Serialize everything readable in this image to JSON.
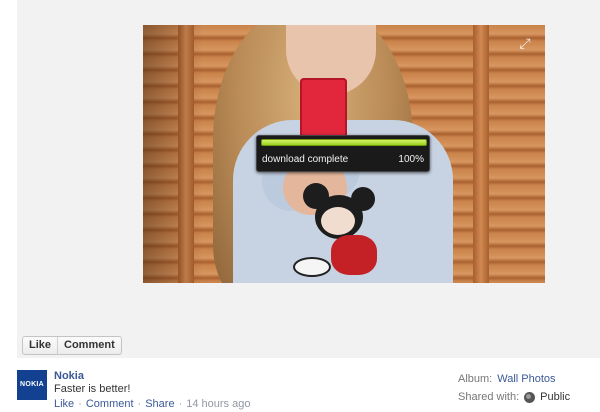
{
  "photo": {
    "expand_icon": "expand-icon",
    "download_overlay": {
      "status_text": "download complete",
      "percent_text": "100%",
      "progress": 1.0,
      "bar_color": "#9ad11d"
    }
  },
  "actions": {
    "like_label": "Like",
    "comment_label": "Comment"
  },
  "post": {
    "avatar_text": "NOKIA",
    "author": "Nokia",
    "message": "Faster is better!",
    "meta": {
      "like": "Like",
      "comment": "Comment",
      "share": "Share",
      "time": "14 hours ago",
      "sep": "·"
    },
    "album_label": "Album:",
    "album_value": "Wall Photos",
    "shared_label": "Shared with:",
    "shared_value": "Public",
    "link_color": "#3b5998"
  }
}
